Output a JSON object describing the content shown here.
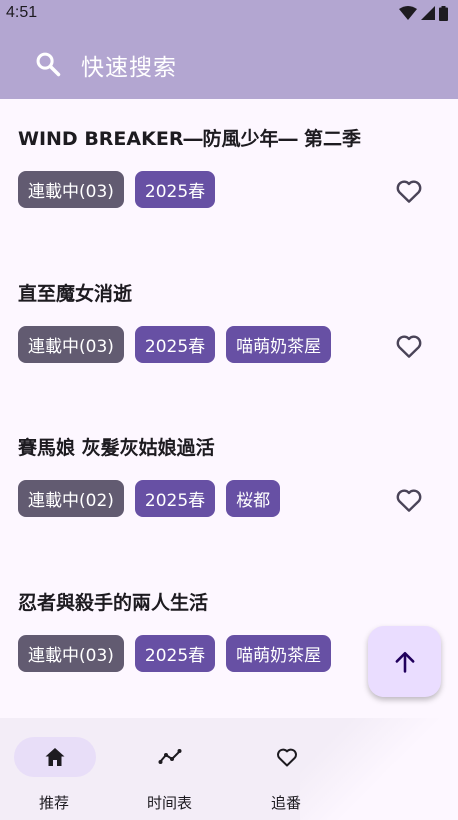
{
  "status_bar": {
    "time": "4:51"
  },
  "search": {
    "placeholder": "快速搜索",
    "icon": "search-icon"
  },
  "colors": {
    "app_bar": "#b3a6d1",
    "background": "#fdf7ff",
    "status_tag": "#625b71",
    "accent_tag": "#6750a4",
    "fab": "#eaddff",
    "nav_bar": "#f3edf7",
    "nav_active_pill": "#e8def8"
  },
  "items": [
    {
      "title": "WIND BREAKER―防風少年― 第二季",
      "status": "連載中(03)",
      "season": "2025春",
      "group": ""
    },
    {
      "title": "直至魔女消逝",
      "status": "連載中(03)",
      "season": "2025春",
      "group": "喵萌奶茶屋"
    },
    {
      "title": "賽馬娘 灰髮灰姑娘過活",
      "status": "連載中(02)",
      "season": "2025春",
      "group": "桜都"
    },
    {
      "title": "忍者與殺手的兩人生活",
      "status": "連載中(03)",
      "season": "2025春",
      "group": "喵萌奶茶屋"
    }
  ],
  "fab": {
    "icon": "arrow-up-icon"
  },
  "nav": {
    "active": "home",
    "items": [
      {
        "label": "推荐",
        "icon": "home-icon"
      },
      {
        "label": "时间表",
        "icon": "timeline-icon"
      },
      {
        "label": "追番",
        "icon": "heart-icon"
      }
    ]
  }
}
